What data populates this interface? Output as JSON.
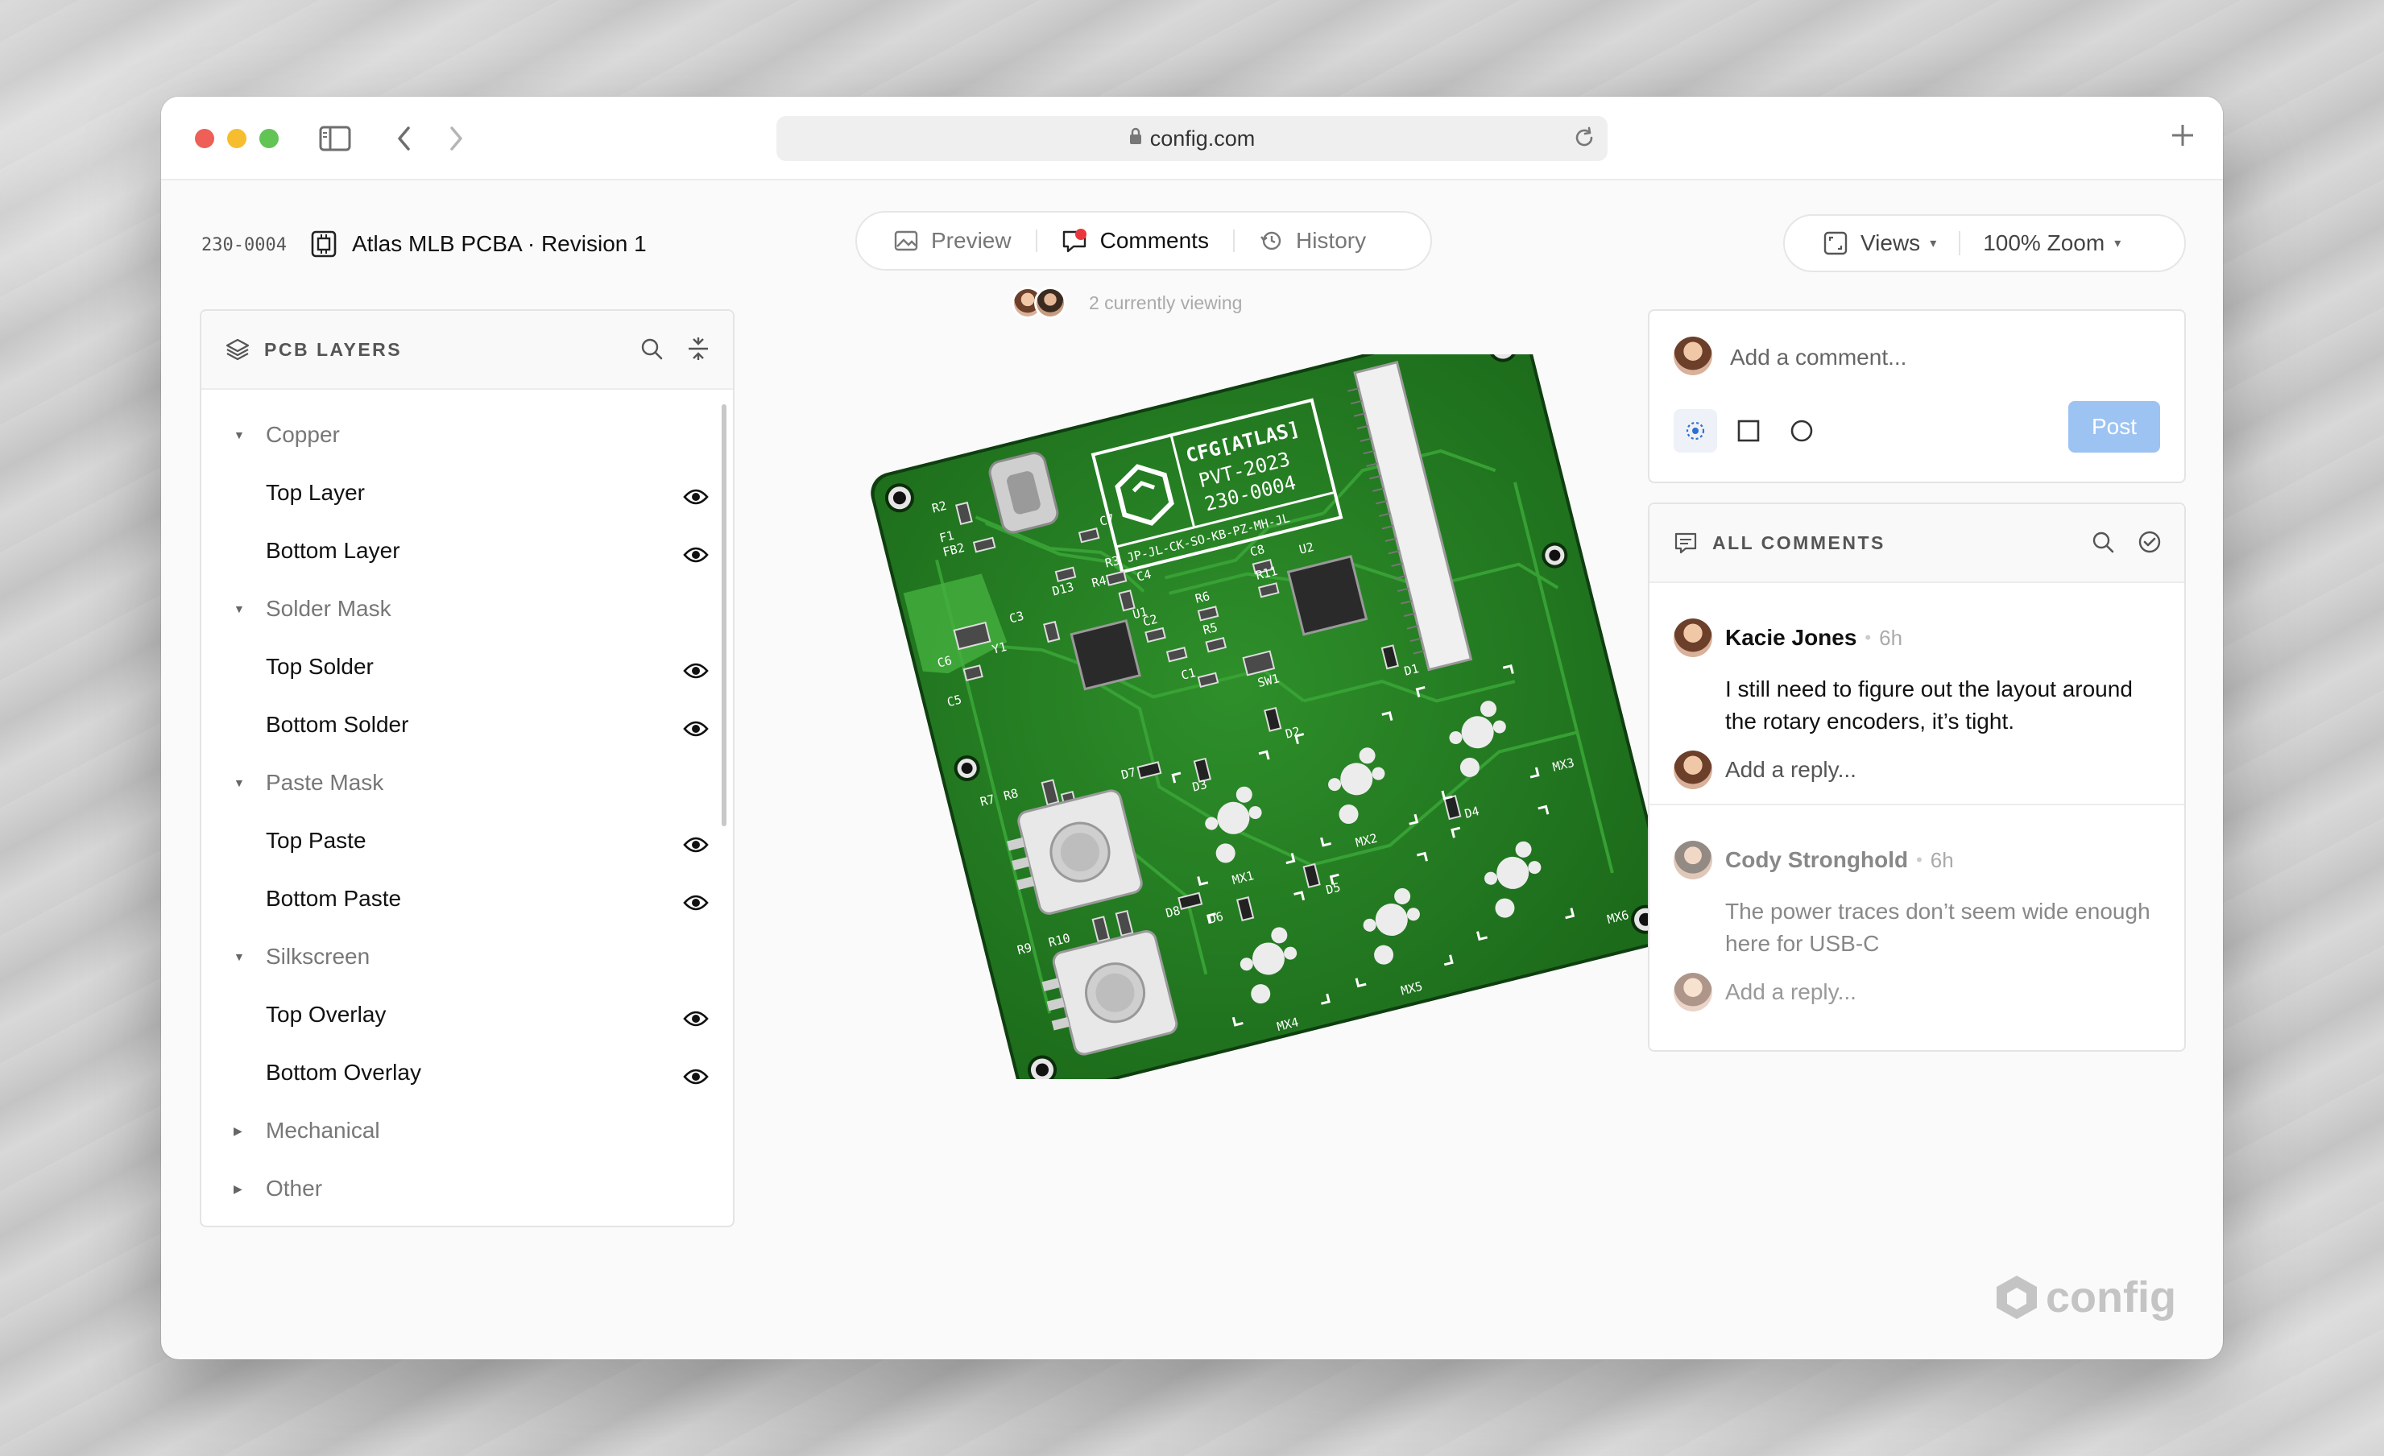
{
  "browser": {
    "url": "config.com"
  },
  "header": {
    "part_number": "230-0004",
    "title": "Atlas MLB PCBA · Revision 1"
  },
  "tabs": [
    {
      "label": "Preview",
      "icon": "image-icon",
      "active": false
    },
    {
      "label": "Comments",
      "icon": "comment-icon",
      "active": true
    },
    {
      "label": "History",
      "icon": "history-icon",
      "active": false
    }
  ],
  "viewers": {
    "text": "2 currently viewing"
  },
  "view_controls": {
    "views_label": "Views",
    "zoom_label": "100% Zoom"
  },
  "layers_panel": {
    "title": "PCB LAYERS",
    "rows": [
      {
        "type": "group",
        "label": "Copper",
        "expanded": true
      },
      {
        "type": "item",
        "label": "Top Layer",
        "visible": true
      },
      {
        "type": "item",
        "label": "Bottom Layer",
        "visible": true
      },
      {
        "type": "group",
        "label": "Solder Mask",
        "expanded": true
      },
      {
        "type": "item",
        "label": "Top Solder",
        "visible": true
      },
      {
        "type": "item",
        "label": "Bottom Solder",
        "visible": true
      },
      {
        "type": "group",
        "label": "Paste Mask",
        "expanded": true
      },
      {
        "type": "item",
        "label": "Top Paste",
        "visible": true
      },
      {
        "type": "item",
        "label": "Bottom Paste",
        "visible": true
      },
      {
        "type": "group",
        "label": "Silkscreen",
        "expanded": true
      },
      {
        "type": "item",
        "label": "Top Overlay",
        "visible": true
      },
      {
        "type": "item",
        "label": "Bottom Overlay",
        "visible": true
      },
      {
        "type": "group",
        "label": "Mechanical",
        "expanded": false
      },
      {
        "type": "group",
        "label": "Other",
        "expanded": false
      }
    ]
  },
  "board": {
    "silk_title": "CFG[ATLAS]",
    "silk_line2": "PVT-2023",
    "silk_line3": "230-0004",
    "silk_initials": "JP-JL-CK-SO-KB-PZ-MH-JL",
    "labels": [
      "R2",
      "F1",
      "FB2",
      "C7",
      "D13",
      "R3",
      "R4",
      "C4",
      "U2",
      "C3",
      "Y1",
      "C6",
      "C5",
      "U1",
      "C2",
      "R6",
      "R5",
      "C1",
      "C8",
      "R11",
      "SW1",
      "D2",
      "D1",
      "D3",
      "MX1",
      "MX2",
      "MX3",
      "D7",
      "R7",
      "R8",
      "D4",
      "D5",
      "D6",
      "D8",
      "R9",
      "R10",
      "MX4",
      "MX5",
      "MX6"
    ],
    "colors": {
      "mask": "#1f7a1f",
      "silk": "#ffffff",
      "pad": "#d9d9d9"
    }
  },
  "composer": {
    "placeholder": "Add a comment...",
    "post_label": "Post"
  },
  "comments_panel": {
    "title": "ALL COMMENTS",
    "comments": [
      {
        "author": "Kacie Jones",
        "time": "6h",
        "body": "I still need to figure out the layout around the rotary encoders, it’s tight.",
        "reply_placeholder": "Add a reply...",
        "resolved": false
      },
      {
        "author": "Cody Stronghold",
        "time": "6h",
        "body": "The power traces don’t seem wide enough here for USB-C",
        "reply_placeholder": "Add a reply...",
        "resolved": true
      }
    ]
  },
  "brand": {
    "logo_text": "config"
  }
}
